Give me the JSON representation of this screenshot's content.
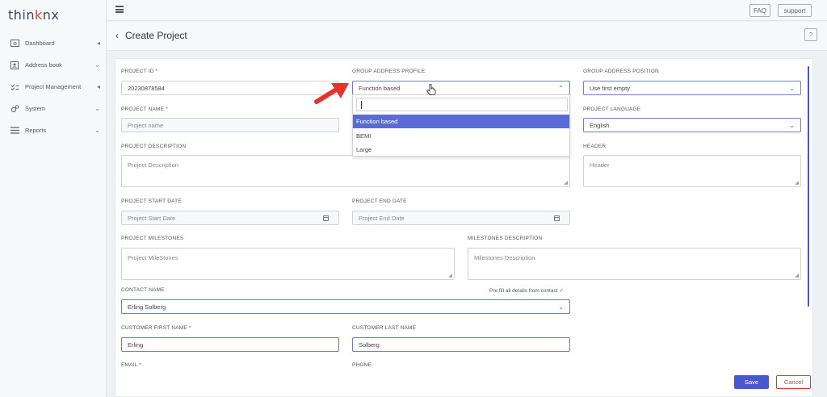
{
  "app": {
    "logo_prefix": "thin",
    "logo_k": "k",
    "logo_suffix": "nx"
  },
  "sidebar": {
    "items": [
      {
        "label": "Dashboard",
        "icon": "dashboard-icon",
        "chevron": "◂"
      },
      {
        "label": "Address book",
        "icon": "contacts-icon",
        "chevron": "⌄"
      },
      {
        "label": "Project Management",
        "icon": "checklist-icon",
        "chevron": "◂"
      },
      {
        "label": "System",
        "icon": "gears-icon",
        "chevron": "⌄"
      },
      {
        "label": "Reports",
        "icon": "list-icon",
        "chevron": "⌄"
      }
    ]
  },
  "topbar": {
    "faq_label": "FAQ",
    "support_label": "support"
  },
  "page": {
    "title": "Create Project",
    "back_glyph": "‹",
    "help_label": "?"
  },
  "form": {
    "project_id": {
      "label": "PROJECT ID *",
      "value": "20230878584"
    },
    "group_address_profile": {
      "label": "GROUP ADDRESS PROFILE",
      "value": "Function based"
    },
    "group_address_position": {
      "label": "GROUP ADDRESS POSITION",
      "value": "Use first empty"
    },
    "project_name": {
      "label": "PROJECT NAME *",
      "placeholder": "Project name"
    },
    "project_language": {
      "label": "PROJECT LANGUAGE",
      "value": "English"
    },
    "project_description": {
      "label": "PROJECT DESCRIPTION",
      "placeholder": "Project Description"
    },
    "header": {
      "label": "HEADER",
      "placeholder": "Header"
    },
    "project_start_date": {
      "label": "PROJECT START DATE",
      "placeholder": "Project Start Date"
    },
    "project_end_date": {
      "label": "PROJECT END DATE",
      "placeholder": "Project End Date"
    },
    "project_milestones": {
      "label": "PROJECT MILESTONES",
      "placeholder": "Project MileStones"
    },
    "milestones_description": {
      "label": "MILESTONES DESCRIPTION",
      "placeholder": "Milestones Description"
    },
    "contact_name": {
      "label": "CONTACT NAME",
      "value": "Erling Solberg"
    },
    "prefill_text": "Pre fill all details from contact ✓",
    "customer_first_name": {
      "label": "CUSTOMER FIRST NAME *",
      "value": "Erling"
    },
    "customer_last_name": {
      "label": "CUSTOMER LAST NAME",
      "value": "Solberg"
    },
    "email": {
      "label": "EMAIL *"
    },
    "phone": {
      "label": "PHONE"
    }
  },
  "dropdown": {
    "options": [
      "Function based",
      "BEMI",
      "Large"
    ],
    "selected": "Function based"
  },
  "actions": {
    "save_label": "Save",
    "cancel_label": "Cancel"
  },
  "colors": {
    "accent": "#4a57d3",
    "selected_option": "#5b6bd6",
    "cancel": "#d9383a",
    "annotation_arrow": "#e8332a"
  }
}
